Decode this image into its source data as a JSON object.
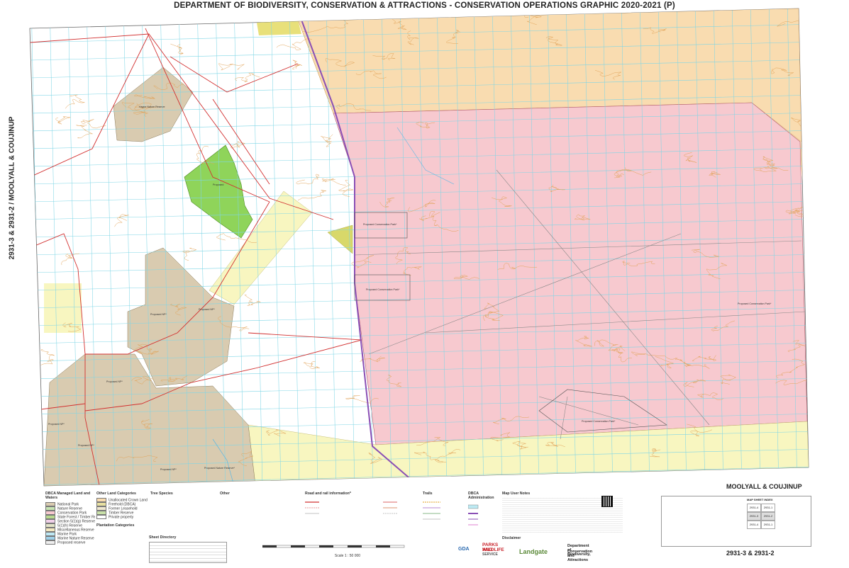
{
  "title": "DEPARTMENT OF BIODIVERSITY, CONSERVATION & ATTRACTIONS - CONSERVATION OPERATIONS GRAPHIC 2020-2021 (P)",
  "side_label": "2931-3 & 2931-2 / MOOLYALL & COUJINUP",
  "sheet_name": "MOOLYALL & COUJINUP",
  "sheet_number": "2931-3 & 2931-2",
  "area_labels": {
    "nature_reserve_nw": "Hayne Nature Reserve",
    "proposed_green": "Proposed",
    "proposed_cp_1": "Proposed Conservation Park*",
    "proposed_cp_2": "Proposed Conservation Park*",
    "proposed_cp_east": "Proposed Conservation Park*",
    "proposed_cp_se": "Proposed Conservation Park*",
    "proposed_np_1": "Proposed NP*",
    "proposed_np_2": "Proposed NP*",
    "proposed_np_3": "Proposed NP*",
    "proposed_np_4": "Proposed NP*",
    "proposed_np_5": "Proposed NP*",
    "proposed_np_6": "Proposed NP*",
    "proposed_nr_s": "Proposed Nature Reserve*"
  },
  "legend": {
    "col1_title": "DBCA Managed Land and Waters",
    "col1_items": [
      "National Park",
      "Nature Reserve",
      "Conservation Park",
      "State Forest / Timber Reserve",
      "Section 5(1)(g) Reserve",
      "5(1)(h) Reserve",
      "Miscellaneous Reserve",
      "Marine Park",
      "Marine Nature Reserve",
      "Proposed reserve"
    ],
    "col2_title": "Other Land Categories",
    "col2_items": [
      "Unallocated Crown Land",
      "Freehold (DBCA)",
      "Former Leasehold",
      "Timber Reserve",
      "Private property"
    ],
    "col2b_title": "Plantation Categories",
    "col3_title": "Tree Species",
    "col4_title": "Other",
    "col5_title": "Road and rail information*",
    "col6_title": "Trails",
    "col7_title": "DBCA Administration",
    "col8_title": "Map User Notes",
    "disclaimer": "Disclaimer",
    "directory_title": "Sheet Directory",
    "scale": "Scale 1 : 50 000"
  },
  "logos": {
    "gda": "GDA",
    "pw1": "PARKS AND",
    "pw2": "WILDLIFE",
    "pw3": "SERVICE",
    "landgate": "Landgate",
    "dbca1": "Department of Biodiversity,",
    "dbca2": "Conservation and Attractions"
  },
  "index_title": "MAP SHEET INDEX",
  "index_cells": [
    "2931-4",
    "2931-1",
    "2931-3",
    "2931-2",
    "2931-4",
    "2931-1"
  ],
  "colors": {
    "national_park": "#d9cbb0",
    "conservation_park": "#f7c9cf",
    "ucl": "#f9dcb0",
    "freehold": "#f8f6c0",
    "green_proposed": "#8fd45a",
    "olive": "#d8d86a",
    "grid": "#7fd6e6",
    "contour": "#e2a45a",
    "road": "#d23030",
    "boundary": "#8a4fb5"
  }
}
